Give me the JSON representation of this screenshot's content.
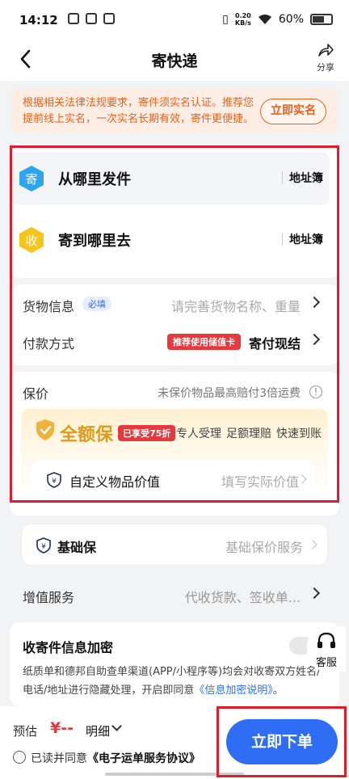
{
  "status_bar": {
    "time": "14:12",
    "net_speed_top": "0.20",
    "net_speed_unit": "KB/s",
    "battery": "60%"
  },
  "nav": {
    "title": "寄快递",
    "share_label": "分享"
  },
  "notice": {
    "text": "根据相关法律法规要求，寄件须实名认证。推荐您提前线上实名，一次实名长期有效，寄件更便捷。",
    "button": "立即实名"
  },
  "sender": {
    "icon_char": "寄",
    "title": "从哪里发件",
    "book": "地址簿"
  },
  "receiver": {
    "icon_char": "收",
    "title": "寄到哪里去",
    "book": "地址簿"
  },
  "goods": {
    "label": "货物信息",
    "badge": "必填",
    "placeholder": "请完善货物名称、重量"
  },
  "payment": {
    "label": "付款方式",
    "tag": "推荐使用储值卡",
    "value": "寄付现结"
  },
  "insurance": {
    "label": "保价",
    "hint": "未保价物品最高赔付3倍运费",
    "full": {
      "name": "全额保",
      "discount": "已享受75折",
      "features": [
        "专人受理",
        "足额理赔",
        "快速到账"
      ]
    },
    "custom": {
      "label": "自定义物品价值",
      "placeholder": "填写实际价值"
    },
    "basic": {
      "label": "基础保",
      "value": "基础保价服务"
    }
  },
  "value_added": {
    "label": "增值服务",
    "value": "代收货款、签收单..."
  },
  "encrypt": {
    "title": "收寄件信息加密",
    "desc": "纸质单和德邦自助查单渠道(APP/小程序等)均会对收寄双方姓名/电话/地址进行隐藏处理，开启即同意",
    "link": "《信息加密说明》",
    "tail": "。"
  },
  "customer_service": "客服",
  "bottom": {
    "estimate_label": "预估",
    "price": "¥--",
    "detail": "明细",
    "agree_prefix": "已读并同意",
    "agree_link": "《电子运单服务协议》",
    "submit": "立即下单"
  },
  "colors": {
    "primary": "#2f6df4",
    "orange": "#e8621c",
    "red": "#e5393d",
    "gold": "#e09a1a",
    "highlight_frame": "#e01b2b"
  }
}
